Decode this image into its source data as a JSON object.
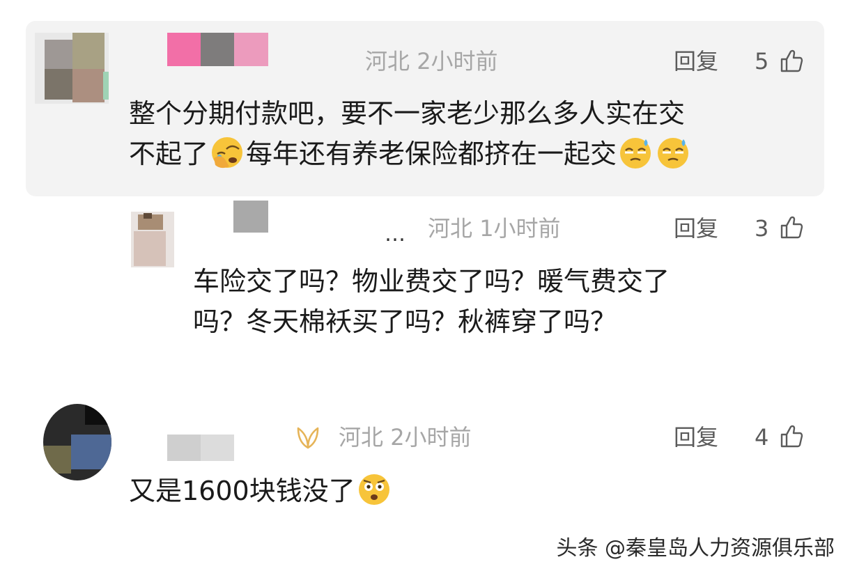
{
  "comments": [
    {
      "location": "河北",
      "time": "2小时前",
      "reply_label": "回复",
      "likes": "5",
      "text_line1": "整个分期付款吧，要不一家老少那么多人实在交",
      "text_line2a": "不起了",
      "text_line2b": "每年还有养老保险都挤在一起交"
    },
    {
      "location": "河北",
      "time": "1小时前",
      "reply_label": "回复",
      "likes": "3",
      "name_suffix": "…",
      "text_line1": "车险交了吗？物业费交了吗？暖气费交了",
      "text_line2": "吗？冬天棉袄买了吗？秋裤穿了吗？"
    },
    {
      "location": "河北",
      "time": "2小时前",
      "reply_label": "回复",
      "likes": "4",
      "text_line1": "又是1600块钱没了"
    }
  ],
  "watermark": "头条 @秦皇岛人力资源俱乐部",
  "icons": {
    "like": "thumbs-up-icon",
    "emoji_facepalm": "crying-facepalm-emoji",
    "emoji_sweat": "sweat-smile-emoji",
    "emoji_shock": "shocked-emoji",
    "badge": "ribbon-badge-icon"
  },
  "colors": {
    "highlight_bg": "#f3f3f3",
    "meta_gray": "#a6a6a6",
    "badge_gold": "#e6b458"
  }
}
